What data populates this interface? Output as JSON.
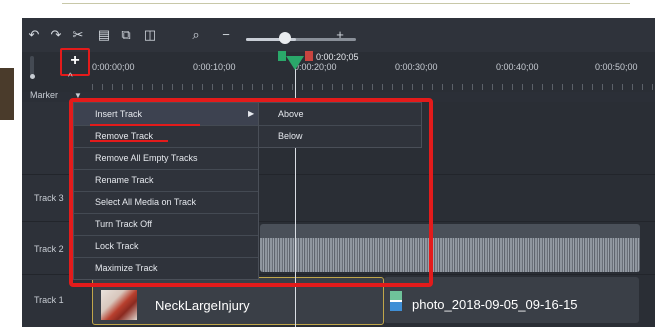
{
  "ruler": {
    "playhead_time": "0:00:20;05",
    "ticks": [
      "0:00:00;00",
      "0:00:10;00",
      "0:00:20;00",
      "0:00:30;00",
      "0:00:40;00",
      "0:00:50;00"
    ],
    "add_button_label": "+"
  },
  "toolbar": {
    "zoom_minus": "−",
    "zoom_plus": "+",
    "zoom_level": 0.45
  },
  "marker": {
    "label": "Marker"
  },
  "tracks": [
    {
      "label": "Track 3"
    },
    {
      "label": "Track 2"
    },
    {
      "label": "Track 1"
    }
  ],
  "clips": {
    "clip1_label": "NeckLargeInjury",
    "clip2_label": "photo_2018-09-05_09-16-15"
  },
  "context_menu": {
    "items": [
      {
        "label": "Insert Track",
        "has_submenu": true
      },
      {
        "label": "Remove Track"
      },
      {
        "label": "Remove All Empty Tracks"
      },
      {
        "label": "Rename Track"
      },
      {
        "label": "Select All Media on Track"
      },
      {
        "label": "Turn Track Off"
      },
      {
        "label": "Lock Track"
      },
      {
        "label": "Maximize Track"
      }
    ],
    "submenu": [
      {
        "label": "Above"
      },
      {
        "label": "Below"
      }
    ]
  },
  "colors": {
    "highlight": "#e31b1b",
    "playhead": "#2aa86a",
    "clip_border": "#c0a64a"
  },
  "icons": [
    "undo-icon",
    "redo-icon",
    "cut-icon",
    "copy-icon",
    "paste-icon",
    "split-icon",
    "magnifier-icon"
  ]
}
